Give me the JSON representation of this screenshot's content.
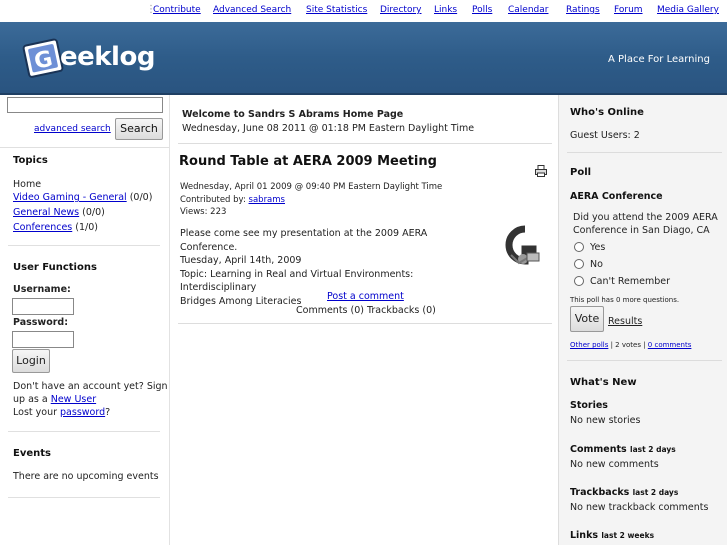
{
  "nav": {
    "items": [
      "Contribute",
      "Advanced Search",
      "Site Statistics",
      "Directory",
      "Links",
      "Polls",
      "Calendar",
      "Ratings",
      "Forum",
      "Media Gallery"
    ]
  },
  "header": {
    "logo_text": "eeklog",
    "tagline": "A Place For Learning"
  },
  "search": {
    "advanced_link": "advanced search",
    "button_label": "Search",
    "input_value": ""
  },
  "topics": {
    "title": "Topics",
    "home": "Home",
    "items": [
      {
        "label": "Video Gaming - General",
        "count": "(0/0)"
      },
      {
        "label": "General News",
        "count": "(0/0)"
      },
      {
        "label": "Conferences",
        "count": "(1/0)"
      }
    ]
  },
  "user_functions": {
    "title": "User Functions",
    "username_label": "Username:",
    "password_label": "Password:",
    "login_label": "Login",
    "no_account_1": "Don't have an account yet? Sign",
    "no_account_2": "up as a",
    "new_user_link": "New User",
    "lost_prefix": "Lost your",
    "password_link": "password",
    "lost_suffix": "?"
  },
  "events": {
    "title": "Events",
    "text": "There are no upcoming events"
  },
  "welcome": {
    "title": "Welcome to Sandrs S Abrams Home Page",
    "date": "Wednesday, June 08 2011 @ 01:18 PM Eastern Daylight Time"
  },
  "story": {
    "title": "Round Table at AERA 2009 Meeting",
    "date": "Wednesday, April 01 2009 @ 09:40 PM Eastern Daylight Time",
    "contributed_prefix": "Contributed by:",
    "author": "sabrams",
    "views": "Views: 223",
    "body_lines": [
      "Please come see my presentation at the 2009 AERA Conference.",
      "Tuesday, April 14th, 2009",
      "Topic: Learning in Real and Virtual Environments: Interdisciplinary",
      "Bridges Among Literacies"
    ],
    "post_comment": "Post a comment",
    "comments_line": "Comments (0) Trackbacks (0)"
  },
  "whos_online": {
    "title": "Who's Online",
    "guests": "Guest Users: 2"
  },
  "poll": {
    "title": "Poll",
    "name": "AERA Conference",
    "question_lines": [
      "Did you attend the 2009 AERA",
      "Conference in San Diago, CA"
    ],
    "options": [
      "Yes",
      "No",
      "Can't Remember"
    ],
    "more_questions": "This poll has 0 more questions.",
    "vote_label": "Vote",
    "results_link": "Results",
    "other_polls": "Other polls",
    "votes_text": " | 2 votes | ",
    "comments_link": "0 comments"
  },
  "whats_new": {
    "title": "What's New",
    "stories_title": "Stories",
    "stories_text": "No new stories",
    "comments_title": "Comments",
    "comments_suffix": "last 2 days",
    "comments_text": "No new comments",
    "trackbacks_title": "Trackbacks",
    "trackbacks_suffix": "last 2 days",
    "trackbacks_text": "No new trackback comments",
    "links_title": "Links",
    "links_suffix": "last 2 weeks"
  },
  "colors": {
    "header_blue": "#2e5c89",
    "link_blue": "#0000cc"
  }
}
